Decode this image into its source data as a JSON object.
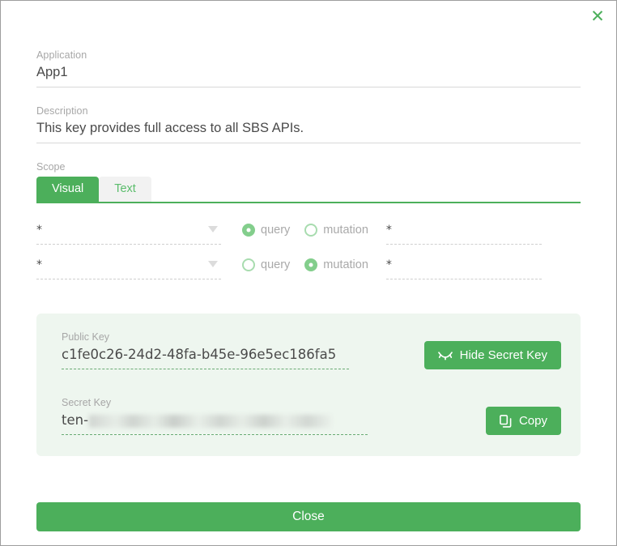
{
  "dialog": {
    "close_icon": "close-icon",
    "close_glyph": "✕"
  },
  "fields": {
    "application": {
      "label": "Application",
      "value": "App1"
    },
    "description": {
      "label": "Description",
      "value": "This key provides full access to all SBS APIs."
    }
  },
  "scope": {
    "label": "Scope",
    "tabs": [
      {
        "label": "Visual",
        "active": true
      },
      {
        "label": "Text",
        "active": false
      }
    ],
    "rows": [
      {
        "type_value": "*",
        "operations": [
          {
            "label": "query",
            "checked": true
          },
          {
            "label": "mutation",
            "checked": false
          }
        ],
        "field_value": "*"
      },
      {
        "type_value": "*",
        "operations": [
          {
            "label": "query",
            "checked": false
          },
          {
            "label": "mutation",
            "checked": true
          }
        ],
        "field_value": "*"
      }
    ]
  },
  "keys": {
    "public": {
      "label": "Public Key",
      "value": "c1fe0c26-24d2-48fa-b45e-96e5ec186fa5"
    },
    "secret": {
      "label": "Secret Key",
      "value_prefix": "ten-",
      "masked": true
    },
    "hide_button": {
      "label": "Hide Secret Key",
      "icon": "eye-slash-icon"
    },
    "copy_button": {
      "label": "Copy",
      "icon": "copy-icon"
    }
  },
  "footer": {
    "close_label": "Close"
  },
  "colors": {
    "accent_green": "#4caf5b",
    "panel_bg": "#eef6ef",
    "radio_green": "#83ce8c",
    "label_gray": "#a7a7a7"
  }
}
